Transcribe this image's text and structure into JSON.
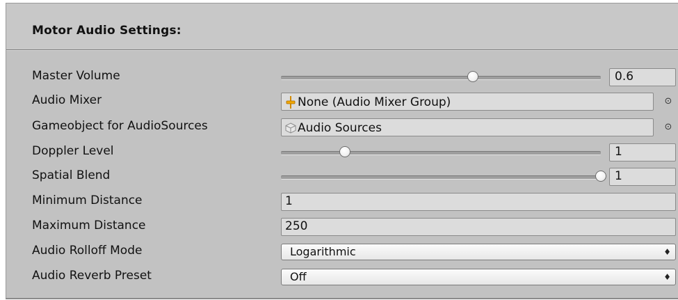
{
  "header": {
    "title": "Motor Audio Settings:"
  },
  "fields": {
    "master_volume": {
      "label": "Master Volume",
      "value": "0.6",
      "level": 0.6
    },
    "audio_mixer": {
      "label": "Audio Mixer",
      "value": "None (Audio Mixer Group)",
      "icon": "audio-mixer-group-icon"
    },
    "audio_sources": {
      "label": "Gameobject for AudioSources",
      "value": "Audio Sources",
      "icon": "gameobject-cube-icon"
    },
    "doppler_level": {
      "label": "Doppler Level",
      "value": "1",
      "level": 0.2
    },
    "spatial_blend": {
      "label": "Spatial Blend",
      "value": "1",
      "level": 1.0
    },
    "minimum_distance": {
      "label": "Minimum Distance",
      "value": "1"
    },
    "maximum_distance": {
      "label": "Maximum Distance",
      "value": "250"
    },
    "rolloff_mode": {
      "label": "Audio Rolloff Mode",
      "value": "Logarithmic"
    },
    "reverb_preset": {
      "label": "Audio Reverb Preset",
      "value": "Off"
    }
  },
  "icons": {
    "object_picker": "object-picker-icon",
    "dropdown": "dropdown-arrows-icon"
  }
}
